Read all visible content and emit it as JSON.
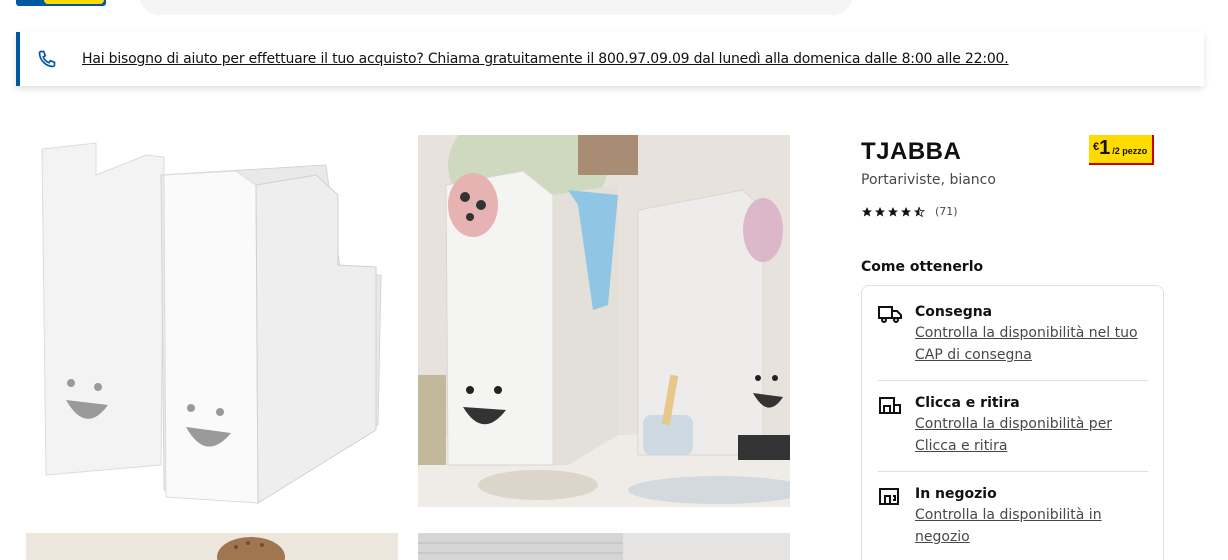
{
  "help_banner": {
    "text": "Hai bisogno di aiuto per effettuare il tuo acquisto? Chiama gratuitamente il 800.97.09.09 dal lunedì alla domenica dalle 8:00 alle 22:00.",
    "icon": "phone-icon"
  },
  "product": {
    "name": "TJABBA",
    "description": "Portariviste, bianco",
    "price": {
      "currency": "€",
      "value": "1",
      "unit": "/2 pezzo"
    },
    "rating": {
      "stars": 4.5,
      "count": "(71)"
    }
  },
  "availability": {
    "title": "Come ottenerlo",
    "options": [
      {
        "icon": "truck-icon",
        "title": "Consegna",
        "link_line1": "Controlla la disponibilità nel tuo",
        "link_line2": "CAP di consegna"
      },
      {
        "icon": "click-collect-icon",
        "title": "Clicca e ritira",
        "link_line1": "Controlla la disponibilità per",
        "link_line2": "Clicca e ritira"
      },
      {
        "icon": "store-icon",
        "title": "In negozio",
        "link_line1": "Controlla la disponibilità in",
        "link_line2": "negozio"
      }
    ]
  },
  "colors": {
    "brand_blue": "#0058a3",
    "price_yellow": "#ffdb00",
    "price_red": "#cc0008"
  }
}
